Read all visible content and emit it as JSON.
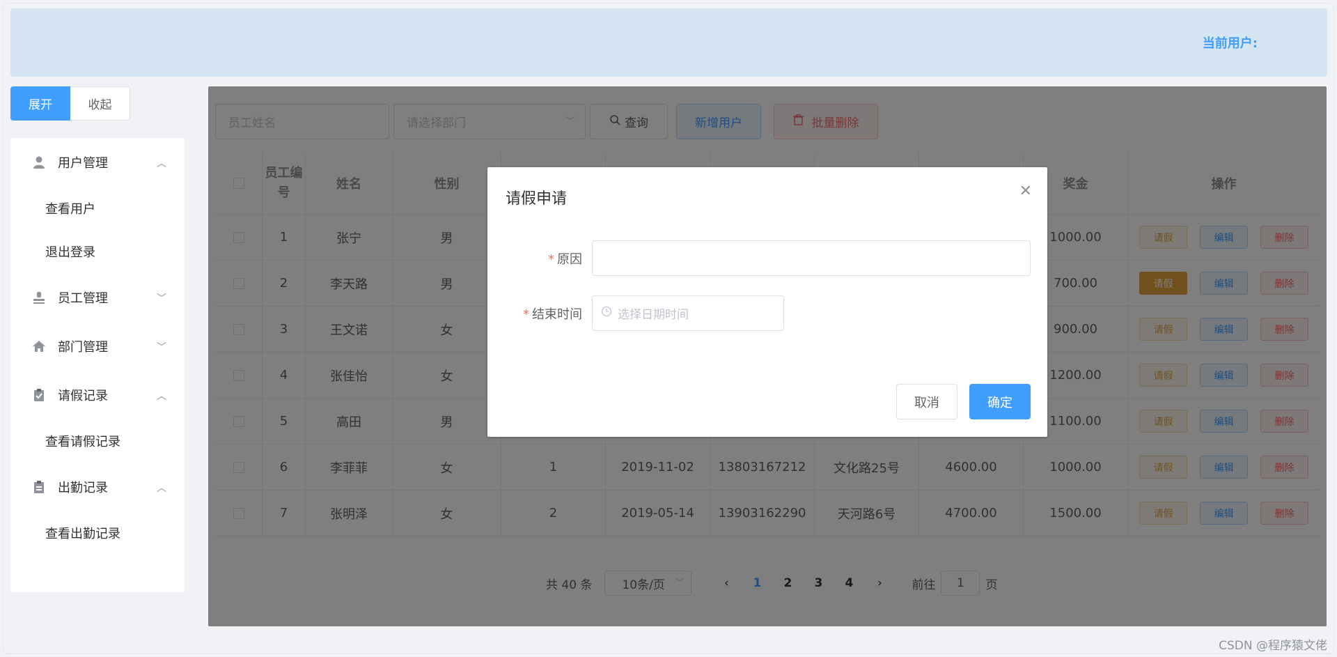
{
  "header": {
    "current_user_label": "当前用户:"
  },
  "toggle": {
    "expand": "展开",
    "collapse": "收起"
  },
  "sidebar": {
    "groups": [
      {
        "label": "用户管理",
        "icon": "user-icon",
        "expanded": true,
        "items": [
          "查看用户",
          "退出登录"
        ]
      },
      {
        "label": "员工管理",
        "icon": "employee-icon",
        "expanded": false,
        "items": []
      },
      {
        "label": "部门管理",
        "icon": "home-icon",
        "expanded": false,
        "items": []
      },
      {
        "label": "请假记录",
        "icon": "clipboard-check-icon",
        "expanded": true,
        "items": [
          "查看请假记录"
        ]
      },
      {
        "label": "出勤记录",
        "icon": "clipboard-icon",
        "expanded": true,
        "items": [
          "查看出勤记录"
        ]
      }
    ]
  },
  "toolbar": {
    "name_placeholder": "员工姓名",
    "dept_placeholder": "请选择部门",
    "search_label": "查询",
    "add_label": "新增用户",
    "batch_delete_label": "批量删除"
  },
  "table": {
    "headers": [
      "",
      "员工编号",
      "姓名",
      "性别",
      "",
      "",
      "",
      "",
      "",
      "奖金",
      "操作"
    ],
    "rows": [
      {
        "id": "1",
        "name": "张宁",
        "gender": "男",
        "dept": "",
        "date": "",
        "phone": "",
        "address": "",
        "salary": "",
        "bonus": "1000.00"
      },
      {
        "id": "2",
        "name": "李天路",
        "gender": "男",
        "dept": "",
        "date": "",
        "phone": "",
        "address": "",
        "salary": "",
        "bonus": "700.00"
      },
      {
        "id": "3",
        "name": "王文诺",
        "gender": "女",
        "dept": "",
        "date": "",
        "phone": "",
        "address": "",
        "salary": "",
        "bonus": "900.00"
      },
      {
        "id": "4",
        "name": "张佳怡",
        "gender": "女",
        "dept": "",
        "date": "",
        "phone": "",
        "address": "",
        "salary": "",
        "bonus": "1200.00"
      },
      {
        "id": "5",
        "name": "高田",
        "gender": "男",
        "dept": "",
        "date": "",
        "phone": "",
        "address": "",
        "salary": "",
        "bonus": "1100.00"
      },
      {
        "id": "6",
        "name": "李菲菲",
        "gender": "女",
        "dept": "1",
        "date": "2019-11-02",
        "phone": "13803167212",
        "address": "文化路25号",
        "salary": "4600.00",
        "bonus": "1000.00"
      },
      {
        "id": "7",
        "name": "张明泽",
        "gender": "女",
        "dept": "2",
        "date": "2019-05-14",
        "phone": "13903162290",
        "address": "天河路6号",
        "salary": "4700.00",
        "bonus": "1500.00"
      }
    ],
    "op_leave": "请假",
    "op_edit": "编辑",
    "op_delete": "删除"
  },
  "pagination": {
    "total_text": "共 40 条",
    "page_size": "10条/页",
    "pages": [
      "1",
      "2",
      "3",
      "4"
    ],
    "current_page": "1",
    "goto_prefix": "前往",
    "goto_value": "1",
    "goto_suffix": "页"
  },
  "dialog": {
    "title": "请假申请",
    "reason_label": "原因",
    "end_time_label": "结束时间",
    "end_time_placeholder": "选择日期时间",
    "cancel_label": "取消",
    "confirm_label": "确定"
  },
  "watermark": "CSDN @程序猿文佬",
  "colors": {
    "primary": "#409eff",
    "warning": "#e6a23c",
    "danger": "#f56c6c"
  }
}
